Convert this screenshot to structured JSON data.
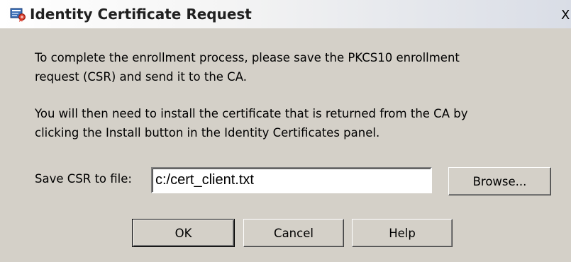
{
  "window": {
    "title": "Identity Certificate Request",
    "close_glyph": "X",
    "icon": "certificate-icon"
  },
  "body": {
    "paragraph1_line1": "To complete the enrollment process, please save the PKCS10 enrollment",
    "paragraph1_line2": "request (CSR) and send it to the CA.",
    "paragraph2_line1": "You will then need to install the certificate that is returned from the CA by",
    "paragraph2_line2": "clicking the Install button in the Identity Certificates panel."
  },
  "csr_field": {
    "label": "Save CSR to file:",
    "value": "c:/cert_client.txt",
    "browse_label": "Browse..."
  },
  "buttons": {
    "ok_label": "OK",
    "cancel_label": "Cancel",
    "help_label": "Help"
  },
  "colors": {
    "dialog_bg": "#d4d0c8",
    "title_text": "#202020"
  }
}
